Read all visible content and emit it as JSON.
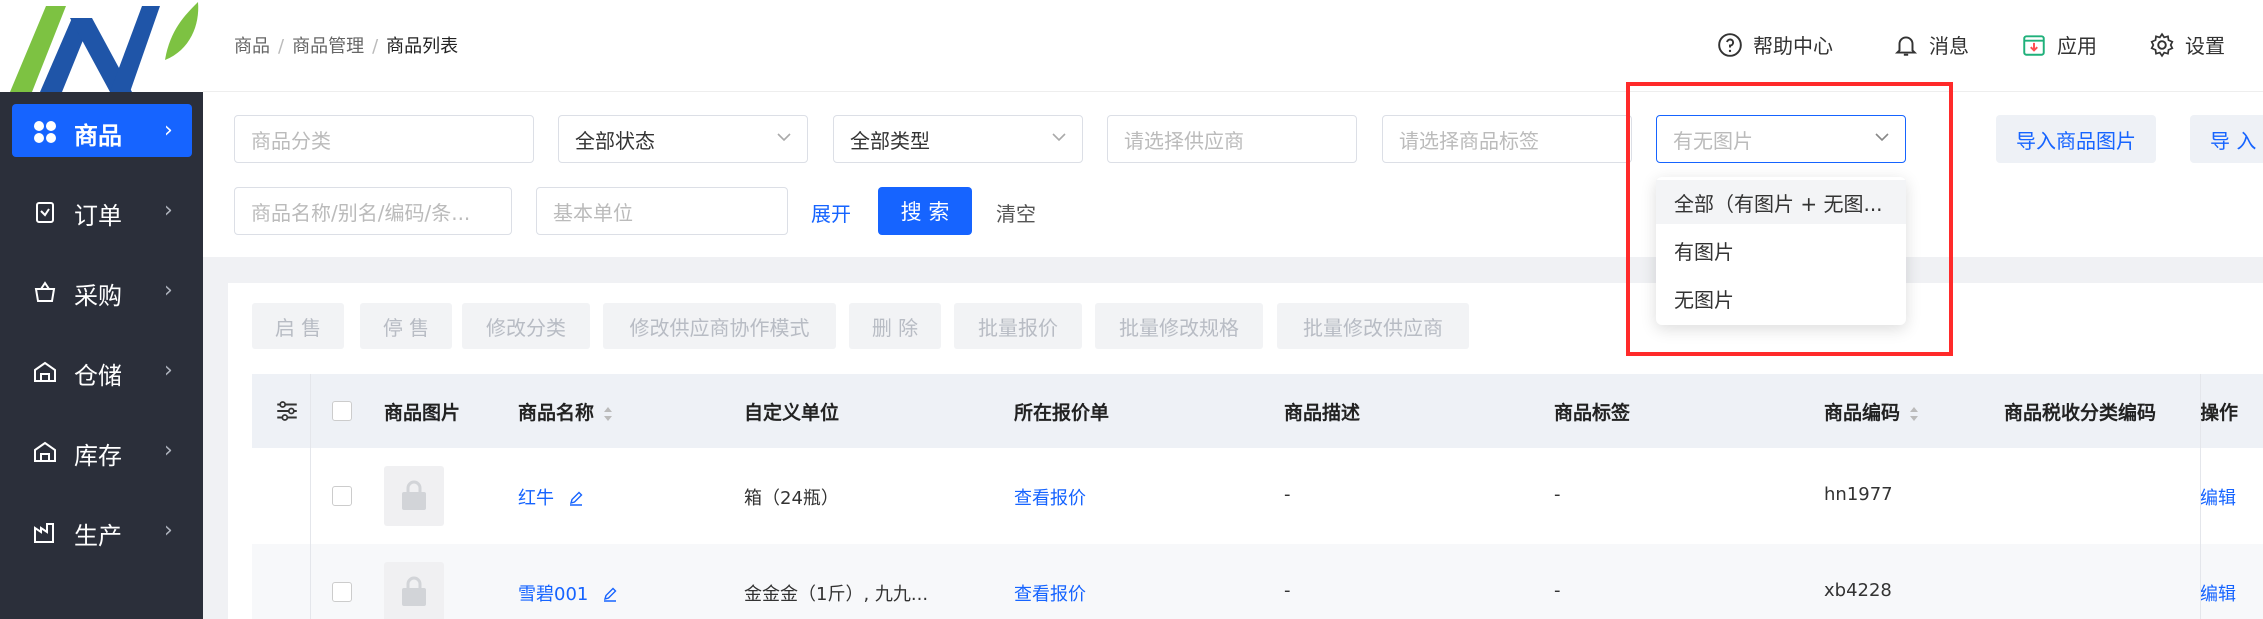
{
  "breadcrumb": {
    "item1": "商品",
    "item2": "商品管理",
    "current": "商品列表",
    "sep": "/"
  },
  "header_actions": {
    "help": "帮助中心",
    "messages": "消息",
    "apps": "应用",
    "settings": "设置"
  },
  "sidebar": {
    "items": [
      {
        "label": "商品",
        "icon": "product-icon",
        "active": true
      },
      {
        "label": "订单",
        "icon": "order-icon"
      },
      {
        "label": "采购",
        "icon": "purchase-icon"
      },
      {
        "label": "仓储",
        "icon": "warehouse-icon"
      },
      {
        "label": "库存",
        "icon": "inventory-icon"
      },
      {
        "label": "生产",
        "icon": "production-icon"
      }
    ],
    "chevron": "›"
  },
  "filters": {
    "category_placeholder": "商品分类",
    "status_value": "全部状态",
    "type_value": "全部类型",
    "supplier_placeholder": "请选择供应商",
    "tag_placeholder": "请选择商品标签",
    "image_placeholder": "有无图片",
    "import_images": "导入商品图片",
    "import_more": "导 入",
    "name_placeholder": "商品名称/别名/编码/条...",
    "unit_placeholder": "基本单位",
    "expand": "展开",
    "search": "搜 索",
    "clear": "清空"
  },
  "image_dropdown": {
    "options": [
      "全部（有图片 + 无图...",
      "有图片",
      "无图片"
    ]
  },
  "action_buttons": [
    "启 售",
    "停 售",
    "修改分类",
    "修改供应商协作模式",
    "删 除",
    "批量报价",
    "批量修改规格",
    "批量修改供应商"
  ],
  "table": {
    "headers": {
      "image": "商品图片",
      "name": "商品名称",
      "unit": "自定义单位",
      "quote": "所在报价单",
      "desc": "商品描述",
      "tag": "商品标签",
      "code": "商品编码",
      "tax": "商品税收分类编码",
      "ops": "操作"
    },
    "rows": [
      {
        "name": "红牛",
        "unit": "箱（24瓶）",
        "quote": "查看报价",
        "desc": "-",
        "tag": "-",
        "code": "hn1977",
        "op": "编辑"
      },
      {
        "name": "雪碧001",
        "unit": "金金金（1斤）, 九九...",
        "quote": "查看报价",
        "desc": "-",
        "tag": "-",
        "code": "xb4228",
        "op": "编辑"
      }
    ]
  },
  "colors": {
    "primary": "#1664ff",
    "sidebar_bg": "#2b2f3a",
    "highlight_box": "#ff2a2a"
  }
}
